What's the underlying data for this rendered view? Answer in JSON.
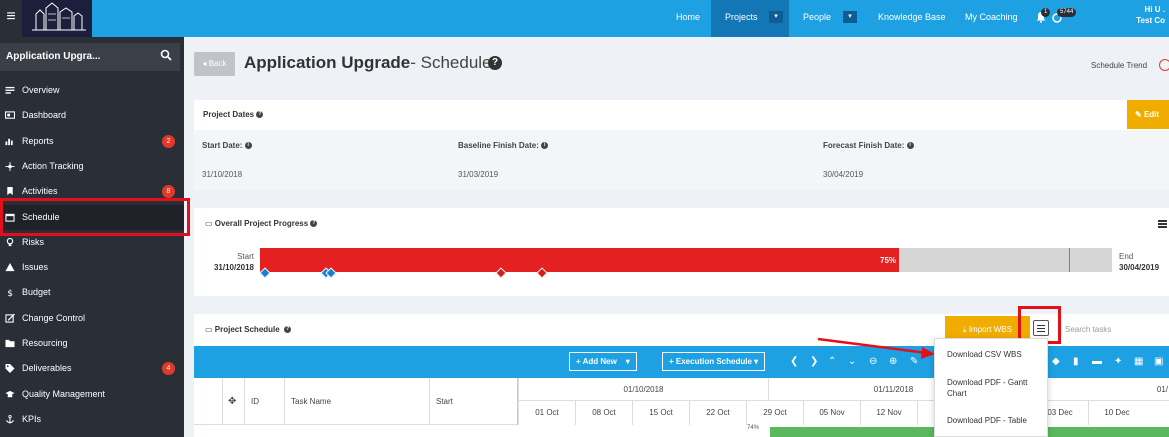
{
  "topbar": {
    "menu_glyph": "≡",
    "nav": [
      {
        "label": "Home"
      },
      {
        "label": "Projects"
      },
      {
        "label": "People"
      },
      {
        "label": "Knowledge Base"
      },
      {
        "label": "My Coaching"
      }
    ],
    "caret_glyph": "▾",
    "notification_count": "1",
    "message_count": "5744",
    "greeting": "Hi U .",
    "company": "Test Co"
  },
  "sidebar": {
    "search_text": "Application Upgra...",
    "items": [
      {
        "label": "Overview",
        "icon": "list-icon"
      },
      {
        "label": "Dashboard",
        "icon": "dashboard-icon"
      },
      {
        "label": "Reports",
        "icon": "bar-chart-icon",
        "badge": "2"
      },
      {
        "label": "Action Tracking",
        "icon": "crosshair-icon"
      },
      {
        "label": "Activities",
        "icon": "bookmark-icon",
        "badge": "8"
      },
      {
        "label": "Schedule",
        "icon": "calendar-icon"
      },
      {
        "label": "Risks",
        "icon": "lightbulb-icon"
      },
      {
        "label": "Issues",
        "icon": "warning-icon"
      },
      {
        "label": "Budget",
        "icon": "dollar-icon"
      },
      {
        "label": "Change Control",
        "icon": "edit-icon"
      },
      {
        "label": "Resourcing",
        "icon": "folder-icon"
      },
      {
        "label": "Deliverables",
        "icon": "tag-icon",
        "badge": "4"
      },
      {
        "label": "Quality Management",
        "icon": "graduation-cap-icon"
      },
      {
        "label": "KPIs",
        "icon": "anchor-icon"
      }
    ]
  },
  "header": {
    "back_label": "Back",
    "title_bold": "Application Upgrade",
    "title_rest": "- Schedule",
    "trend_label": "Schedule Trend"
  },
  "project_dates": {
    "title": "Project Dates",
    "edit_label": "Edit",
    "start_label": "Start Date:",
    "baseline_label": "Baseline Finish Date:",
    "forecast_label": "Forecast Finish Date:",
    "start_value": "31/10/2018",
    "baseline_value": "31/03/2019",
    "forecast_value": "30/04/2019"
  },
  "progress": {
    "title": "Overall Project Progress",
    "start_label": "Start",
    "start_date": "31/10/2018",
    "end_label": "End",
    "end_date": "30/04/2019",
    "percent_label": "75%",
    "percent_value": 0.75,
    "baseline_fraction": 0.95
  },
  "schedule": {
    "title": "Project Schedule",
    "import_label": "Import WBS",
    "search_placeholder": "Search tasks",
    "add_new_label": "+ Add New",
    "exec_schedule_label": "+ Execution Schedule",
    "dropdown_caret": "▾",
    "columns": [
      "ID",
      "Task Name",
      "Start"
    ],
    "months": [
      "01/10/2018",
      "01/11/2018",
      "01/"
    ],
    "weeks": [
      "01 Oct",
      "08 Oct",
      "15 Oct",
      "22 Oct",
      "29 Oct",
      "05 Nov",
      "12 Nov",
      "",
      "",
      "03 Dec",
      "10 Dec"
    ],
    "row_percent": "74%"
  },
  "export_menu": {
    "items": [
      "Download CSV WBS",
      "Download PDF - Gantt Chart",
      "Download PDF - Table"
    ]
  },
  "colors": {
    "accent": "#1da1e2",
    "sidebar": "#2a2e36",
    "progress": "#e52020",
    "warning": "#f0ad00",
    "highlight": "#e2101b"
  }
}
